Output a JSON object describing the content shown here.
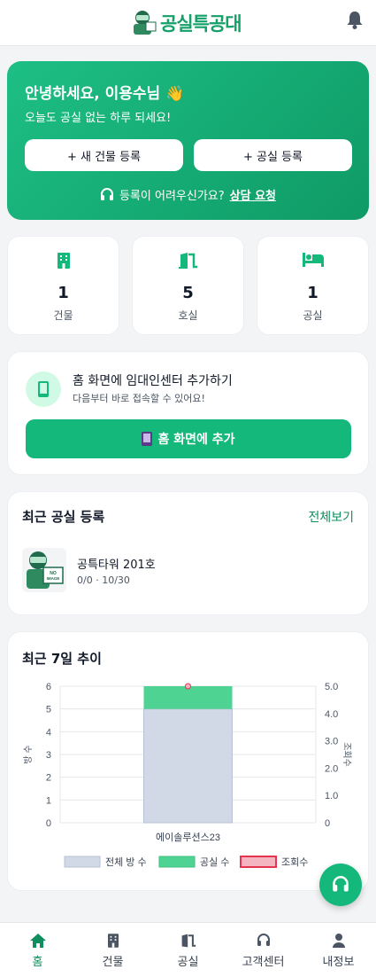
{
  "header": {
    "logo_text": "공실특공대",
    "logo_badge": "NO IMAGE"
  },
  "hero": {
    "greeting": "안녕하세요, 이용수님",
    "wave_emoji": "👋",
    "subtitle": "오늘도 공실 없는 하루 되세요!",
    "btn_building": "+ 새 건물 등록",
    "btn_vacancy": "+ 공실 등록",
    "help_text": "등록이 어려우신가요?",
    "help_link": "상담 요청"
  },
  "stats": [
    {
      "value": "1",
      "label": "건물"
    },
    {
      "value": "5",
      "label": "호실"
    },
    {
      "value": "1",
      "label": "공실"
    }
  ],
  "pwa": {
    "title": "홈 화면에 임대인센터 추가하기",
    "subtitle": "다음부터 바로 접속할 수 있어요!",
    "button": "홈 화면에 추가"
  },
  "recent": {
    "title": "최근 공실 등록",
    "see_all": "전체보기",
    "items": [
      {
        "name": "공특타워 201호",
        "meta": "0/0 · 10/30"
      }
    ]
  },
  "trend": {
    "title": "최근 7일 추이"
  },
  "chart_data": {
    "type": "bar",
    "categories": [
      "에이솔루션스23"
    ],
    "series": [
      {
        "name": "전체 방 수",
        "values": [
          5
        ],
        "color": "#d1d9e6",
        "axis": "left"
      },
      {
        "name": "공실 수",
        "values": [
          1
        ],
        "color": "#4ed393",
        "axis": "left",
        "stacked": true
      },
      {
        "name": "조회수",
        "values": [
          5
        ],
        "color": "#e5344f",
        "axis": "right",
        "kind": "line"
      }
    ],
    "ylabel": "방 수",
    "y2label": "조회수",
    "ylim": [
      0,
      6
    ],
    "y2lim": [
      0,
      5
    ],
    "yticks": [
      "0",
      "1",
      "2",
      "3",
      "4",
      "5",
      "6"
    ],
    "y2ticks": [
      "0",
      "1.0",
      "2.0",
      "3.0",
      "4.0",
      "5.0"
    ],
    "legend": "bottom"
  },
  "nav": [
    {
      "label": "홈",
      "icon": "home-icon",
      "active": true
    },
    {
      "label": "건물",
      "icon": "building-icon"
    },
    {
      "label": "공실",
      "icon": "door-icon"
    },
    {
      "label": "고객센터",
      "icon": "headset-icon"
    },
    {
      "label": "내정보",
      "icon": "user-icon"
    }
  ],
  "colors": {
    "brand": "#13b87a",
    "brand_dark": "#0f8f5d"
  }
}
